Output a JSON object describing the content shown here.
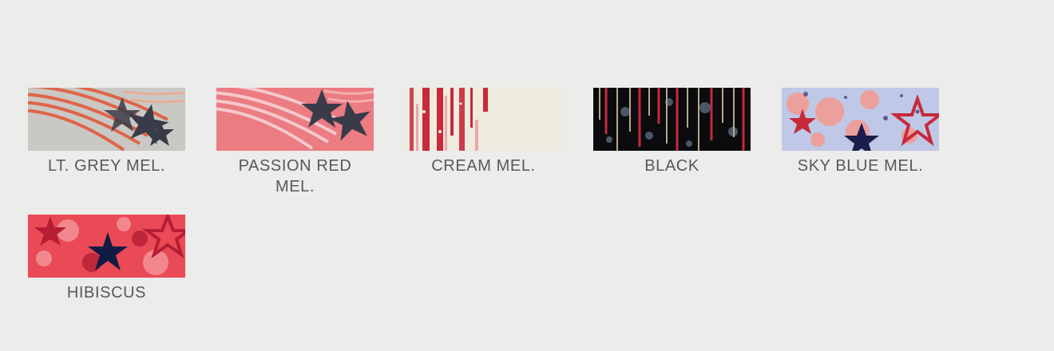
{
  "swatches": [
    {
      "label": "LT. GREY MEL.",
      "pattern": "stripes-stars",
      "colors": {
        "bg": "#c9c8c4",
        "stripe": "#e25a3a",
        "accent": "#f3a58e",
        "star": "#3a3b48"
      }
    },
    {
      "label": "PASSION RED MEL.",
      "pattern": "stripes-stars",
      "colors": {
        "bg": "#ea7c82",
        "stripe": "#f8d7d8",
        "accent": "#f4aeb2",
        "star": "#3a3b48"
      }
    },
    {
      "label": "CREAM MEL.",
      "pattern": "vertical-stripes",
      "colors": {
        "bg": "#efebde",
        "stripe": "#c8293b",
        "accent": "#e88c95"
      }
    },
    {
      "label": "BLACK",
      "pattern": "drips",
      "colors": {
        "bg": "#0b0b0e",
        "stripe": "#c42a3d",
        "accent": "#b8a987",
        "spot": "#5a6b80"
      }
    },
    {
      "label": "SKY BLUE MEL.",
      "pattern": "splatter-stars",
      "colors": {
        "bg": "#bfc8e6",
        "splat": "#f39a8e",
        "star": "#c8293b",
        "star2": "#1b1d4a"
      }
    },
    {
      "label": "HIBISCUS",
      "pattern": "splatter-stars",
      "colors": {
        "bg": "#e94a55",
        "splat": "#f7a3a6",
        "star": "#b51e34",
        "star2": "#131b45"
      }
    }
  ]
}
